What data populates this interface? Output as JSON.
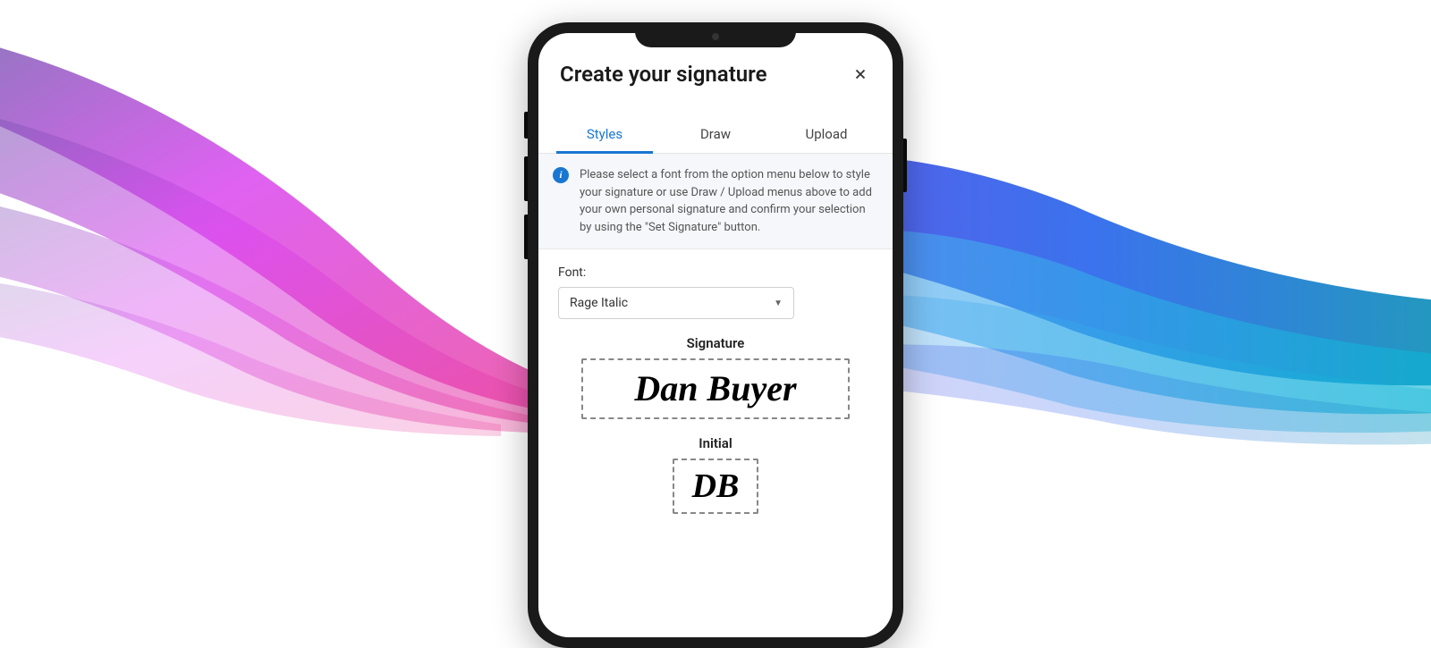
{
  "dialog": {
    "title": "Create your signature"
  },
  "tabs": {
    "styles": "Styles",
    "draw": "Draw",
    "upload": "Upload"
  },
  "info": {
    "text": "Please select a font from the option menu below to style your signature or use Draw / Upload menus above to add your own personal signature and confirm your selection by using the \"Set Signature\" button."
  },
  "font": {
    "label": "Font:",
    "selected": "Rage Italic"
  },
  "signature": {
    "label": "Signature",
    "value": "Dan Buyer"
  },
  "initial": {
    "label": "Initial",
    "value": "DB"
  }
}
